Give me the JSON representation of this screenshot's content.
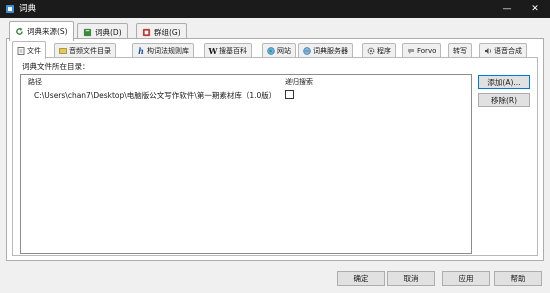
{
  "window": {
    "title": "词典",
    "minimize": "—",
    "close": "✕"
  },
  "outer_tabs": [
    {
      "label": "词典来源(S)",
      "icon": "refresh-icon",
      "active": true
    },
    {
      "label": "词典(D)",
      "icon": "book-icon",
      "active": false
    },
    {
      "label": "群组(G)",
      "icon": "group-icon",
      "active": false
    }
  ],
  "inner_tabs": [
    {
      "label": "文件",
      "icon": "file-icon",
      "active": true
    },
    {
      "label": "音频文件目录",
      "icon": "audio-icon",
      "active": false
    },
    {
      "label": "构词法规则库",
      "icon": "h-icon",
      "active": false
    },
    {
      "label": "搜基百科",
      "icon": "w-icon",
      "active": false
    },
    {
      "label": "网站",
      "icon": "globe-icon",
      "active": false
    },
    {
      "label": "词典服务器",
      "icon": "server-icon",
      "active": false
    },
    {
      "label": "程序",
      "icon": "gear-icon",
      "active": false
    },
    {
      "label": "Forvo",
      "icon": "forvo-icon",
      "active": false
    },
    {
      "label": "转写",
      "icon": "none",
      "active": false
    },
    {
      "label": "语音合成",
      "icon": "speaker-icon",
      "active": false
    }
  ],
  "directory_label": "词典文件所在目录：",
  "list": {
    "headers": {
      "path": "路径",
      "recursive": "递归搜索"
    },
    "rows": [
      {
        "path": "C:\\Users\\chan7\\Desktop\\电脑版公文写作软件\\第一期素材库（1.0版）",
        "recursive": false
      }
    ]
  },
  "side_buttons": {
    "add": "添加(A)...",
    "remove": "移除(R)"
  },
  "bottom_buttons": {
    "ok": "确定",
    "cancel": "取消",
    "apply": "应用",
    "help": "帮助"
  }
}
